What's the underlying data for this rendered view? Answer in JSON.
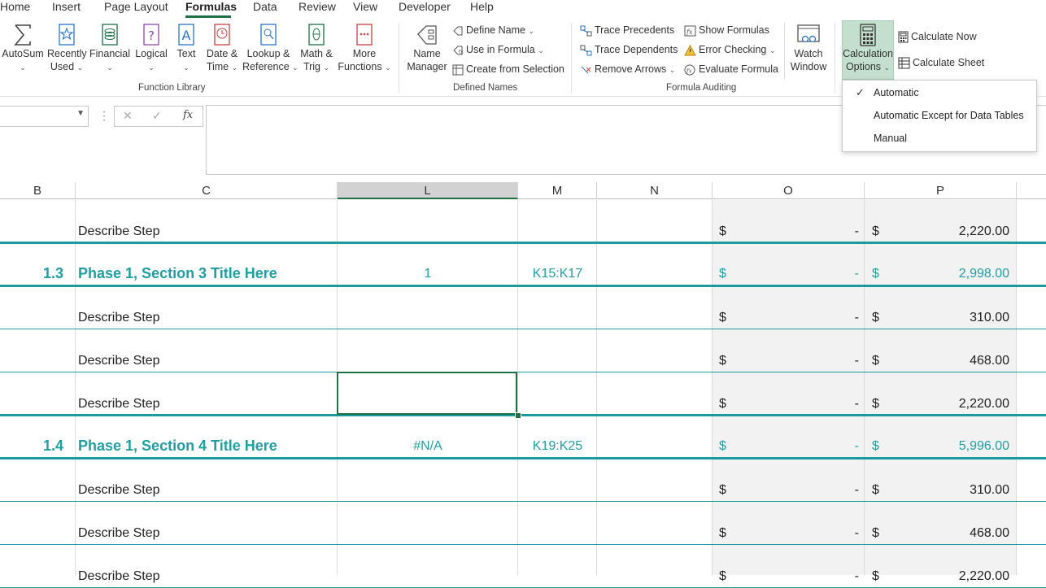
{
  "tabs": [
    {
      "label": "Home",
      "active": false
    },
    {
      "label": "Insert",
      "active": false
    },
    {
      "label": "Page Layout",
      "active": false
    },
    {
      "label": "Formulas",
      "active": true
    },
    {
      "label": "Data",
      "active": false
    },
    {
      "label": "Review",
      "active": false
    },
    {
      "label": "View",
      "active": false
    },
    {
      "label": "Developer",
      "active": false
    },
    {
      "label": "Help",
      "active": false
    }
  ],
  "ribbon": {
    "function_library": {
      "autosum": {
        "line1": "AutoSum",
        "icon": "sigma-icon"
      },
      "recently_used": {
        "line1": "Recently",
        "line2": "Used"
      },
      "financial": {
        "line1": "Financial"
      },
      "logical": {
        "line1": "Logical"
      },
      "text": {
        "line1": "Text"
      },
      "date_time": {
        "line1": "Date &",
        "line2": "Time"
      },
      "lookup_reference": {
        "line1": "Lookup &",
        "line2": "Reference"
      },
      "math_trig": {
        "line1": "Math &",
        "line2": "Trig"
      },
      "more_functions": {
        "line1": "More",
        "line2": "Functions"
      },
      "group_label": "Function Library"
    },
    "defined_names": {
      "name_manager": {
        "line1": "Name",
        "line2": "Manager"
      },
      "define_name": "Define Name",
      "use_in_formula": "Use in Formula",
      "create_from_selection": "Create from Selection",
      "group_label": "Defined Names"
    },
    "formula_auditing": {
      "trace_precedents": "Trace Precedents",
      "trace_dependents": "Trace Dependents",
      "remove_arrows": "Remove Arrows",
      "show_formulas": "Show Formulas",
      "error_checking": "Error Checking",
      "evaluate_formula": "Evaluate Formula",
      "watch_window": {
        "line1": "Watch",
        "line2": "Window"
      },
      "group_label": "Formula Auditing"
    },
    "calculation": {
      "calculation_options": {
        "line1": "Calculation",
        "line2": "Options"
      },
      "calculate_now": "Calculate Now",
      "calculate_sheet": "Calculate Sheet"
    }
  },
  "formula_bar": {
    "cancel": "✕",
    "enter": "✓",
    "fx": "fx",
    "dots": "⋮"
  },
  "calc_dropdown": {
    "items": [
      {
        "label": "Automatic",
        "checked": true
      },
      {
        "label": "Automatic Except for Data Tables",
        "checked": false
      },
      {
        "label": "Manual",
        "checked": false
      }
    ]
  },
  "columns": [
    "B",
    "C",
    "L",
    "M",
    "N",
    "O",
    "P"
  ],
  "selected_column": "L",
  "rows": [
    {
      "num": "",
      "desc": "Describe Step",
      "l": "",
      "m": "",
      "o_cur": "$",
      "o_val": "-",
      "p_cur": "$",
      "p_val": "2,220.00",
      "type": "step"
    },
    {
      "num": "1.3",
      "desc": "Phase 1, Section 3 Title Here",
      "l": "1",
      "m": "K15:K17",
      "o_cur": "$",
      "o_val": "-",
      "p_cur": "$",
      "p_val": "2,998.00",
      "type": "section"
    },
    {
      "num": "",
      "desc": "Describe Step",
      "l": "",
      "m": "",
      "o_cur": "$",
      "o_val": "-",
      "p_cur": "$",
      "p_val": "310.00",
      "type": "step"
    },
    {
      "num": "",
      "desc": "Describe Step",
      "l": "",
      "m": "",
      "o_cur": "$",
      "o_val": "-",
      "p_cur": "$",
      "p_val": "468.00",
      "type": "step"
    },
    {
      "num": "",
      "desc": "Describe Step",
      "l": "",
      "m": "",
      "o_cur": "$",
      "o_val": "-",
      "p_cur": "$",
      "p_val": "2,220.00",
      "type": "step"
    },
    {
      "num": "1.4",
      "desc": "Phase 1, Section 4 Title Here",
      "l": "#N/A",
      "m": "K19:K25",
      "o_cur": "$",
      "o_val": "-",
      "p_cur": "$",
      "p_val": "5,996.00",
      "type": "section"
    },
    {
      "num": "",
      "desc": "Describe Step",
      "l": "",
      "m": "",
      "o_cur": "$",
      "o_val": "-",
      "p_cur": "$",
      "p_val": "310.00",
      "type": "step"
    },
    {
      "num": "",
      "desc": "Describe Step",
      "l": "",
      "m": "",
      "o_cur": "$",
      "o_val": "-",
      "p_cur": "$",
      "p_val": "468.00",
      "type": "step"
    },
    {
      "num": "",
      "desc": "Describe Step",
      "l": "",
      "m": "",
      "o_cur": "$",
      "o_val": "-",
      "p_cur": "$",
      "p_val": "2,220.00",
      "type": "step"
    }
  ],
  "colors": {
    "accent": "#1e7145",
    "teal": "#1f9ea3",
    "shade": "#f2f2f2"
  }
}
